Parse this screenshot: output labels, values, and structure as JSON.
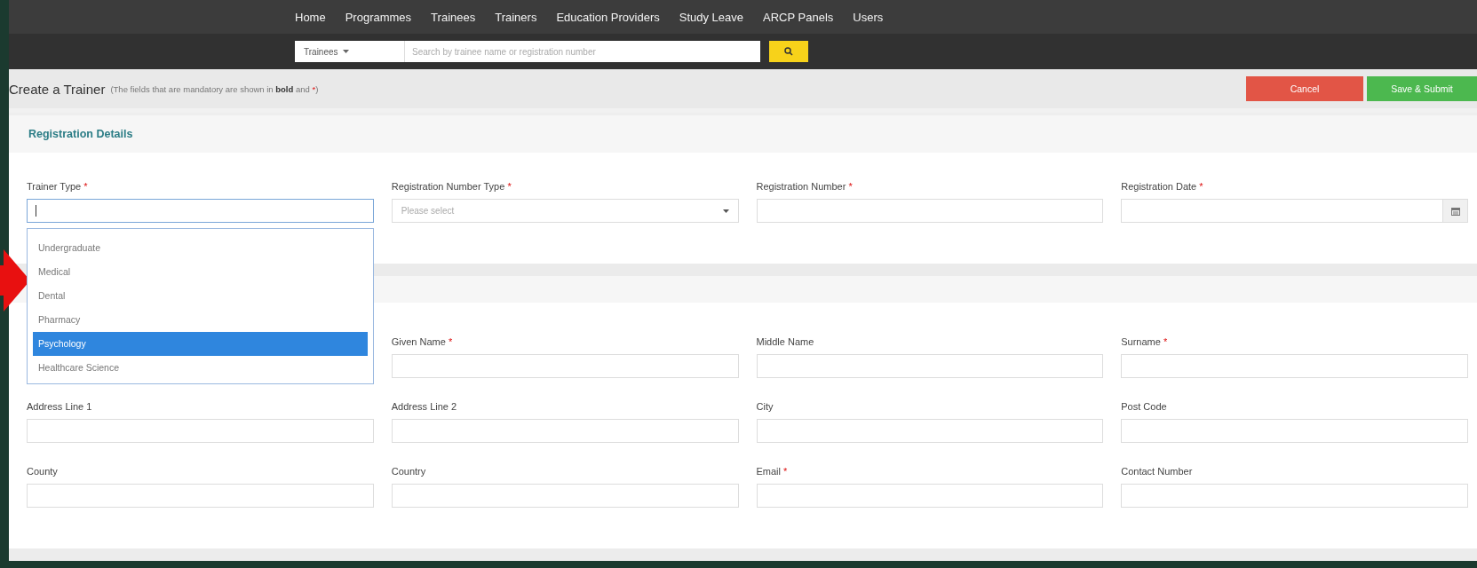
{
  "nav": {
    "items": [
      "Home",
      "Programmes",
      "Trainees",
      "Trainers",
      "Education Providers",
      "Study Leave",
      "ARCP Panels",
      "Users"
    ]
  },
  "search": {
    "scope": "Trainees",
    "placeholder": "Search by trainee name or registration number"
  },
  "header": {
    "title": "Create a Trainer",
    "note": "(The fields that are mandatory are shown in **bold** and",
    "note_mark": "*",
    "note_end": ")"
  },
  "buttons": [
    {
      "label": "Cancel",
      "kind": "cancel"
    },
    {
      "label": "Save & Submit",
      "kind": "submit"
    }
  ],
  "sections": [
    {
      "title": "Registration Details",
      "rows": [
        [
          {
            "label": "Trainer Type",
            "required": true,
            "kind": "combo",
            "open": true,
            "options": [
              {
                "label": "Undergraduate",
                "selected": false
              },
              {
                "label": "Medical",
                "selected": false
              },
              {
                "label": "Dental",
                "selected": false
              },
              {
                "label": "Pharmacy",
                "selected": false
              },
              {
                "label": "Psychology",
                "selected": true
              },
              {
                "label": "Healthcare Science",
                "selected": false
              }
            ]
          },
          {
            "label": "Registration Number Type",
            "required": true,
            "kind": "select",
            "placeholder": "Please select"
          },
          {
            "label": "Registration Number",
            "required": true,
            "kind": "text"
          },
          {
            "label": "Registration Date",
            "required": true,
            "kind": "date"
          }
        ]
      ]
    },
    {
      "rows": [
        [
          "",
          {
            "label": "Given Name",
            "required": true,
            "kind": "text"
          },
          {
            "label": "Middle Name",
            "required": false,
            "kind": "text"
          },
          {
            "label": "Surname",
            "required": true,
            "kind": "text"
          }
        ],
        [
          {
            "label": "Address Line 1",
            "required": false,
            "kind": "text"
          },
          {
            "label": "Address Line 2",
            "required": false,
            "kind": "text"
          },
          {
            "label": "City",
            "required": false,
            "kind": "text"
          },
          {
            "label": "Post Code",
            "required": false,
            "kind": "text"
          }
        ],
        [
          {
            "label": "County",
            "required": false,
            "kind": "text"
          },
          {
            "label": "Country",
            "required": false,
            "kind": "text"
          },
          {
            "label": "Email",
            "required": true,
            "kind": "text"
          },
          {
            "label": "Contact Number",
            "required": false,
            "kind": "text"
          }
        ]
      ]
    }
  ]
}
